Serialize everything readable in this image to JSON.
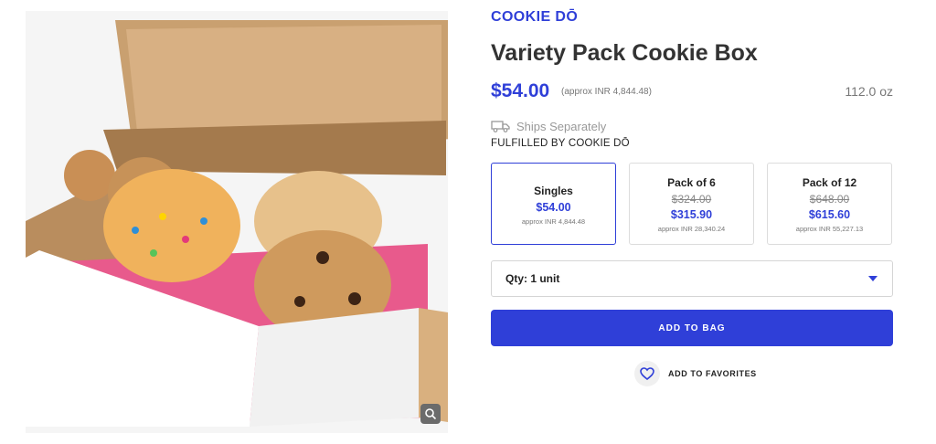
{
  "product": {
    "brand": "COOKIE DŌ",
    "title": "Variety Pack Cookie Box",
    "price": "$54.00",
    "approx_price": "(approx INR 4,844.48)",
    "weight": "112.0 oz",
    "shipping_note": "Ships Separately",
    "fulfilled_by": "FULFILLED BY COOKIE DŌ"
  },
  "options": [
    {
      "name": "Singles",
      "original_price": "",
      "price": "$54.00",
      "approx": "approx INR 4,844.48",
      "selected": true
    },
    {
      "name": "Pack of 6",
      "original_price": "$324.00",
      "price": "$315.90",
      "approx": "approx INR 28,340.24",
      "selected": false
    },
    {
      "name": "Pack of 12",
      "original_price": "$648.00",
      "price": "$615.60",
      "approx": "approx INR 55,227.13",
      "selected": false
    }
  ],
  "quantity": {
    "label": "Qty: 1 unit"
  },
  "actions": {
    "add_to_bag": "ADD TO BAG",
    "add_to_favorites": "ADD TO FAVORITES"
  },
  "icons": {
    "truck": "truck-icon",
    "zoom": "magnify-icon",
    "caret": "caret-down-icon",
    "heart": "heart-icon"
  },
  "colors": {
    "accent": "#2f3fd8",
    "muted_text": "#777777",
    "border": "#dcdcdc"
  }
}
